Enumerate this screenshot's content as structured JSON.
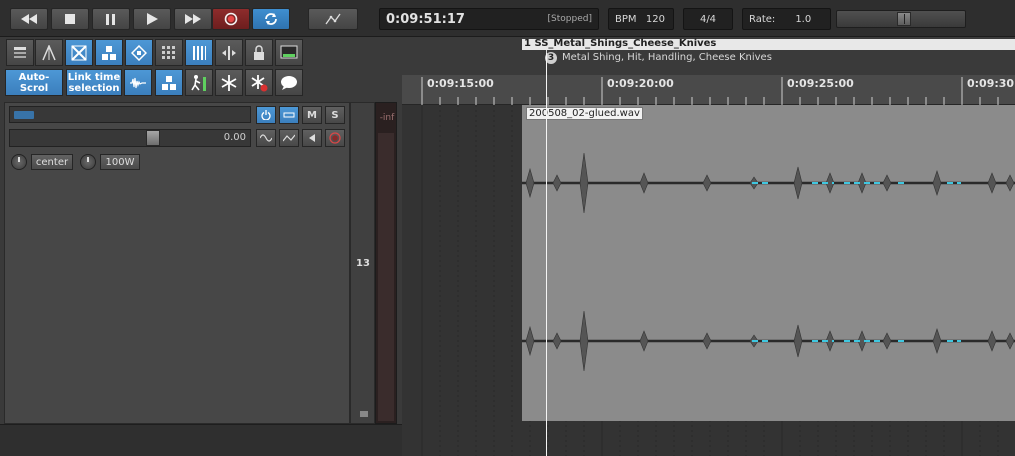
{
  "transport": {
    "time": "0:09:51:17",
    "status": "[Stopped]",
    "bpm_label": "BPM",
    "bpm_value": "120",
    "time_signature": "4/4",
    "rate_label": "Rate:",
    "rate_value": "1.0",
    "buttons": [
      "rewind-icon",
      "stop-icon",
      "pause-icon",
      "play-icon",
      "fast-forward-icon",
      "record-icon",
      "loop-icon",
      "metronome-icon"
    ],
    "colors": {
      "record": "#7a2424",
      "loop": "#3a85c6"
    }
  },
  "tools": {
    "auto_scroll_label": "Auto-Scrol",
    "link_time_label": "Link time selection",
    "icons_row1": [
      "arrange-icon",
      "envelope-tool-icon",
      "cross-icon",
      "grid-snap-icon",
      "ripple-edit-icon",
      "grid-icon",
      "vertical-bars-icon",
      "split-icon",
      "lock-icon",
      "monitor-icon"
    ],
    "icons_row2": [
      "waveform-icon",
      "group-icon",
      "ski-lift-icon",
      "snowflake-icon",
      "snowflake-red-icon",
      "speech-bubble-icon"
    ]
  },
  "track": {
    "number": "13",
    "volume_value": "0.00",
    "pan_label": "center",
    "width_label": "100W",
    "mute_label": "M",
    "solo_label": "S",
    "meter_label": "-inf"
  },
  "timeline": {
    "ruler_labels": [
      "0:09:15:00",
      "0:09:20:00",
      "0:09:25:00",
      "0:09:30:"
    ],
    "marker_region": "1  SS_Metal_Shings_Cheese_Knives",
    "marker_number": "3",
    "marker_text": "Metal Shing, Hit, Handling, Cheese Knives",
    "clip_name": "200508_02-glued.wav",
    "colors": {
      "clip": "#8b8b8b",
      "waveform_accent": "#3fc7e0"
    }
  }
}
